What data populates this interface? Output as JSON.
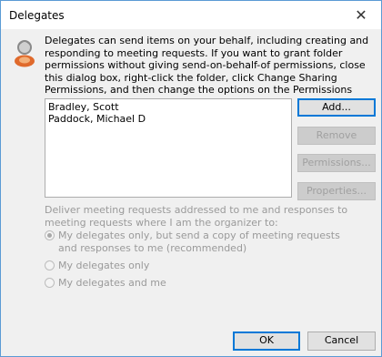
{
  "window": {
    "title": "Delegates",
    "close_glyph": "✕"
  },
  "description": "Delegates can send items on your behalf, including creating and responding to meeting requests. If you want to grant folder permissions without giving send-on-behalf-of permissions, close this dialog box, right-click the folder, click Change Sharing Permissions, and then change the options on the Permissions tab.",
  "delegates": [
    "Bradley, Scott",
    "Paddock, Michael D"
  ],
  "buttons": {
    "add": "Add...",
    "remove": "Remove",
    "permissions": "Permissions...",
    "properties": "Properties...",
    "ok": "OK",
    "cancel": "Cancel"
  },
  "deliver": {
    "label": "Deliver meeting requests addressed to me and responses to meeting requests where I am the organizer to:",
    "options": [
      "My delegates only, but send a copy of meeting requests and responses to me (recommended)",
      "My delegates only",
      "My delegates and me"
    ],
    "selected_index": 0
  },
  "colors": {
    "accent": "#0078d7",
    "border": "#5b9bd5",
    "disabled_text": "#a0a0a0"
  },
  "icons": {
    "dialog": "user-icon",
    "close": "close-icon"
  }
}
